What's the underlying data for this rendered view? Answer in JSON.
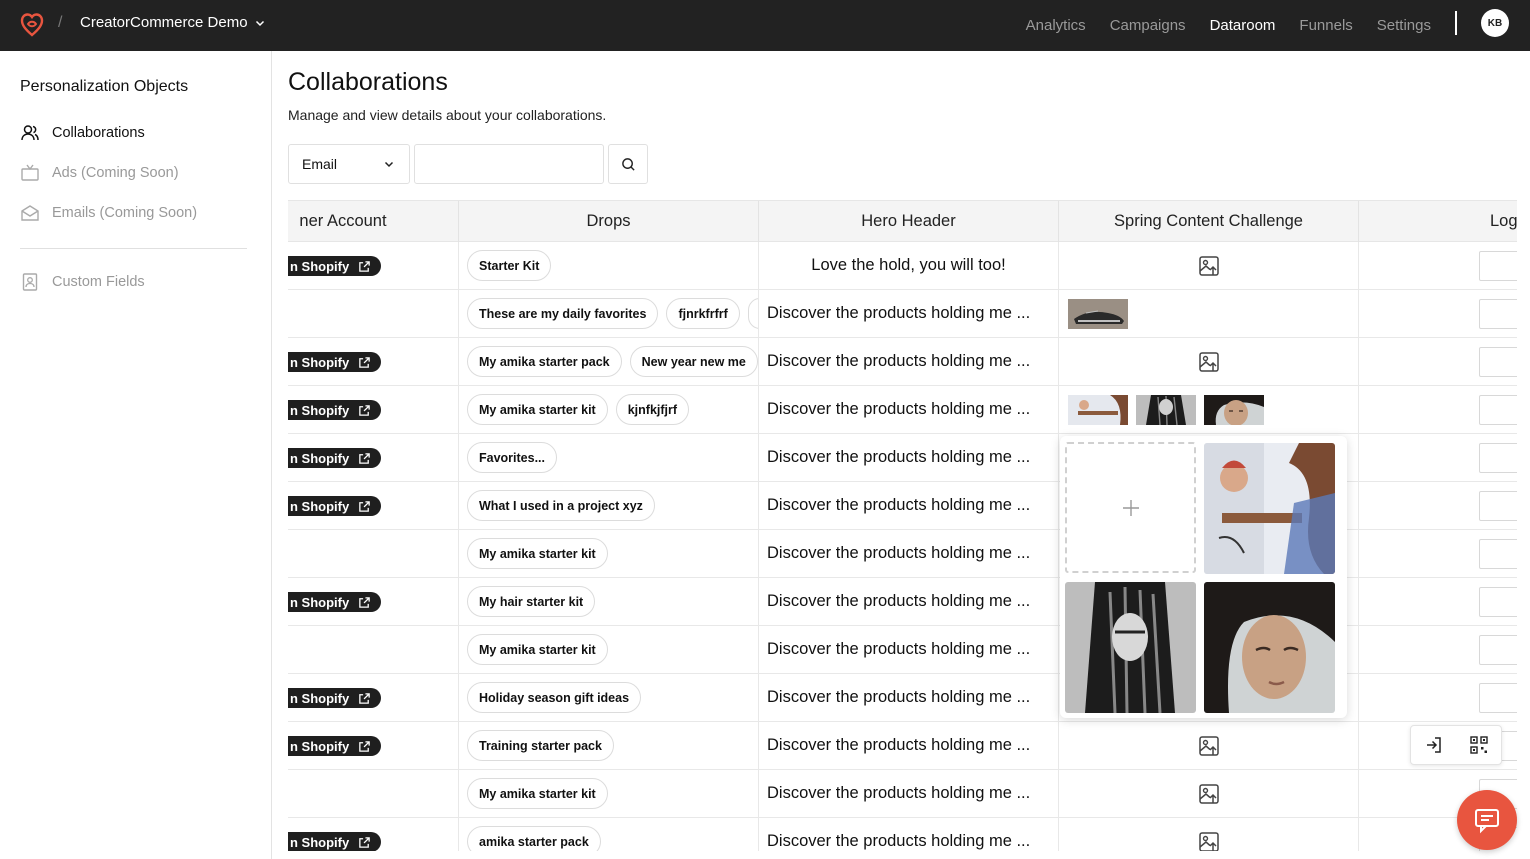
{
  "topbar": {
    "workspace": "CreatorCommerce Demo",
    "separator": "/",
    "nav": [
      {
        "label": "Analytics",
        "active": false
      },
      {
        "label": "Campaigns",
        "active": false
      },
      {
        "label": "Dataroom",
        "active": true
      },
      {
        "label": "Funnels",
        "active": false
      },
      {
        "label": "Settings",
        "active": false
      }
    ],
    "avatar_initials": "KB"
  },
  "sidebar": {
    "title": "Personalization Objects",
    "items": [
      {
        "label": "Collaborations",
        "icon": "users-icon",
        "active": true
      },
      {
        "label": "Ads (Coming Soon)",
        "icon": "tv-icon",
        "active": false
      },
      {
        "label": "Emails (Coming Soon)",
        "icon": "envelope-icon",
        "active": false
      }
    ],
    "custom_fields": "Custom Fields"
  },
  "main": {
    "title": "Collaborations",
    "subtitle": "Manage and view details about your collaborations.",
    "filter": {
      "selected": "Email",
      "search_value": ""
    }
  },
  "table": {
    "headers": {
      "account": "ner Account",
      "drops": "Drops",
      "hero": "Hero Header",
      "challenge": "Spring Content Challenge",
      "log": "Log"
    },
    "shop_label": "n Shopify",
    "rows": [
      {
        "shop": true,
        "drops": [
          "Starter Kit"
        ],
        "hero": "Love the hold, you will too!",
        "media": "icon"
      },
      {
        "shop": false,
        "drops": [
          "These are my daily favorites",
          "fjnrkfrfrf",
          ""
        ],
        "hero": "Discover the products holding me ...",
        "media": "thumbs1"
      },
      {
        "shop": true,
        "drops": [
          "My amika starter pack",
          "New year new me"
        ],
        "hero": "Discover the products holding me ...",
        "media": "icon"
      },
      {
        "shop": true,
        "drops": [
          "My amika starter kit",
          "kjnfkjfjrf"
        ],
        "hero": "Discover the products holding me ...",
        "media": "thumbs3"
      },
      {
        "shop": true,
        "drops": [
          "Favorites..."
        ],
        "hero": "Discover the products holding me ...",
        "media": "none"
      },
      {
        "shop": true,
        "drops": [
          "What I used in a project xyz"
        ],
        "hero": "Discover the products holding me ...",
        "media": "none"
      },
      {
        "shop": false,
        "drops": [
          "My amika starter kit"
        ],
        "hero": "Discover the products holding me ...",
        "media": "none"
      },
      {
        "shop": true,
        "drops": [
          "My hair starter kit"
        ],
        "hero": "Discover the products holding me ...",
        "media": "none"
      },
      {
        "shop": false,
        "drops": [
          "My amika starter kit"
        ],
        "hero": "Discover the products holding me ...",
        "media": "none"
      },
      {
        "shop": true,
        "drops": [
          "Holiday season gift ideas"
        ],
        "hero": "Discover the products holding me ...",
        "media": "none"
      },
      {
        "shop": true,
        "drops": [
          "Training starter pack"
        ],
        "hero": "Discover the products holding me ...",
        "media": "icon"
      },
      {
        "shop": false,
        "drops": [
          "My amika starter kit"
        ],
        "hero": "Discover the products holding me ...",
        "media": "icon"
      },
      {
        "shop": true,
        "drops": [
          "amika starter pack"
        ],
        "hero": "Discover the products holding me ...",
        "media": "icon"
      }
    ]
  },
  "colors": {
    "topbar_bg": "#222222",
    "brand": "#e8553f",
    "pill_bg": "#1f1f1f"
  }
}
